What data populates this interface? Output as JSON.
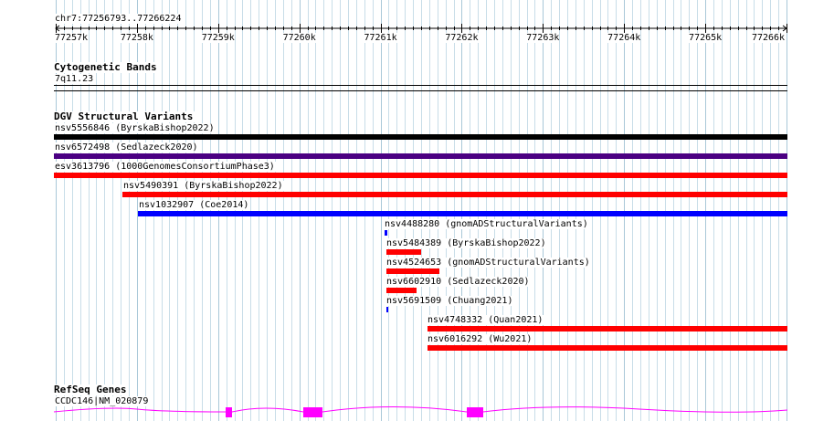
{
  "ruler": {
    "range_label": "chr7:77256793..77266224",
    "ticks": [
      "77257k",
      "77258k",
      "77259k",
      "77260k",
      "77261k",
      "77262k",
      "77263k",
      "77264k",
      "77265k",
      "77266k"
    ]
  },
  "cytoband": {
    "title": "Cytogenetic Bands",
    "band": "7q11.23"
  },
  "dgv": {
    "title": "DGV Structural Variants",
    "features": [
      {
        "label": "nsv5556846 (ByrskaBishop2022)",
        "color": "#000000"
      },
      {
        "label": "nsv6572498 (Sedlazeck2020)",
        "color": "#4b0082"
      },
      {
        "label": "esv3613796 (1000GenomesConsortiumPhase3)",
        "color": "#ff0000"
      },
      {
        "label": "nsv5490391 (ByrskaBishop2022)",
        "color": "#ff0000"
      },
      {
        "label": "nsv1032907 (Coe2014)",
        "color": "#0000ff"
      },
      {
        "label": "nsv4488280 (gnomADStructuralVariants)",
        "color": "#0000ff"
      },
      {
        "label": "nsv5484389 (ByrskaBishop2022)",
        "color": "#ff0000"
      },
      {
        "label": "nsv4524653 (gnomADStructuralVariants)",
        "color": "#ff0000"
      },
      {
        "label": "nsv6602910 (Sedlazeck2020)",
        "color": "#ff0000"
      },
      {
        "label": "nsv5691509 (Chuang2021)",
        "color": "#0000ff"
      },
      {
        "label": "nsv4748332 (Quan2021)",
        "color": "#ff0000"
      },
      {
        "label": "nsv6016292 (Wu2021)",
        "color": "#ff0000"
      }
    ]
  },
  "refseq": {
    "title": "RefSeq Genes",
    "gene_label": "CCDC146|NM_020879",
    "color": "#ff00ff"
  }
}
